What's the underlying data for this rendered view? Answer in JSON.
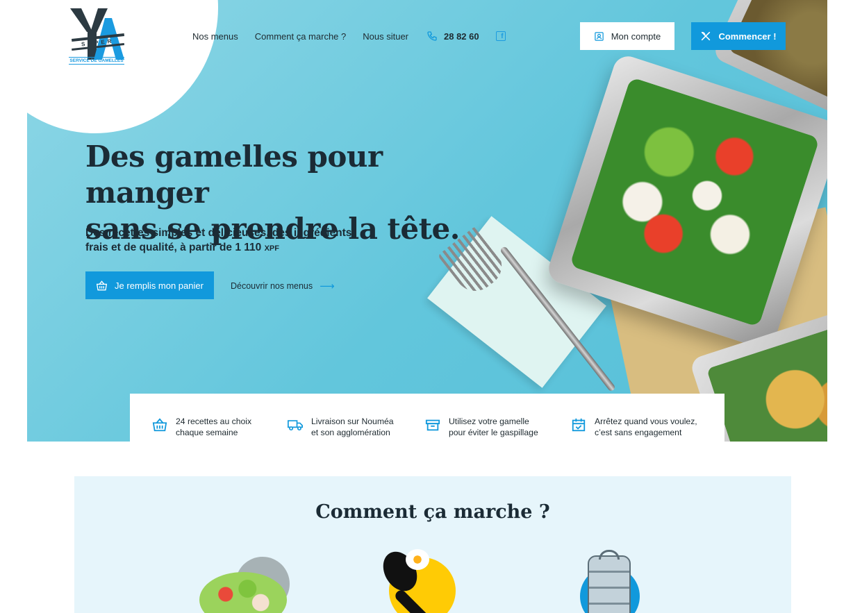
{
  "brand": {
    "logo_letters": "YA",
    "logo_super": "SUPER",
    "logo_tagline": "SERVICE DE GAMELLES"
  },
  "nav": {
    "items": [
      "Nos menus",
      "Comment ça marche ?",
      "Nous situer"
    ],
    "phone": "28 82 60",
    "facebook_icon": "facebook-icon",
    "account_label": "Mon compte",
    "start_label": "Commencer !"
  },
  "hero": {
    "title_line1": "Des gamelles pour manger",
    "title_line2": "sans se prendre la tête.",
    "lead_line1": "Des recettes simples et délicieuses, des ingrédients",
    "lead_line2": "frais et de qualité, à partir de 1 110",
    "lead_currency": "XPF",
    "cart_button": "Je remplis mon panier",
    "menus_link": "Découvrir nos menus"
  },
  "features": [
    {
      "icon": "basket-icon",
      "line1": "24 recettes au choix",
      "line2": "chaque semaine"
    },
    {
      "icon": "truck-icon",
      "line1": "Livraison sur Nouméa",
      "line2": "et son agglomération"
    },
    {
      "icon": "box-icon",
      "line1": "Utilisez votre gamelle",
      "line2": "pour éviter le gaspillage"
    },
    {
      "icon": "calendar-check-icon",
      "line1": "Arrêtez quand vous voulez,",
      "line2": "c’est sans engagement"
    }
  ],
  "how": {
    "title": "Comment ça marche ?"
  },
  "colors": {
    "accent": "#1199dc",
    "hero_bg": "#62c6dc",
    "section_bg": "#e6f5fb",
    "text": "#1b2b35"
  }
}
